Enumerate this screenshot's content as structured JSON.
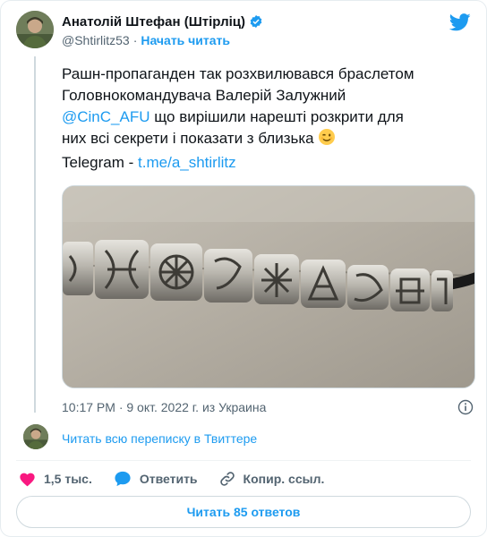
{
  "author": {
    "display_name": "Анатолій Штефан (Штірліц)",
    "handle": "@Shtirlitz53",
    "separator": "·",
    "follow_label": "Начать читать"
  },
  "tweet": {
    "line1": "Рашн-пропаганден так розхвилювався браслетом",
    "line2": "Головнокомандувача Валерій Залужний",
    "mention": "@CinC_AFU",
    "line3_rest": " що вирішили нарешті розкрити для",
    "line4": "них всі секрети і показати з близька",
    "telegram_prefix": "Telegram - ",
    "telegram_link": "t.me/a_shtirlitz"
  },
  "meta": {
    "timestamp": "10:17 PM · 9 окт. 2022 г. из Украина"
  },
  "thread": {
    "read_full": "Читать всю переписку в Твиттере"
  },
  "actions": {
    "likes": "1,5 тыс.",
    "reply": "Ответить",
    "copy_link": "Копир. ссыл."
  },
  "replies_button": "Читать 85 ответов",
  "colors": {
    "accent": "#1d9bf0",
    "like": "#f91880",
    "text": "#0f1419",
    "secondary": "#536471"
  },
  "icons": {
    "brand": "twitter-bird-icon",
    "verified": "verified-badge-icon",
    "info": "info-icon",
    "like": "heart-icon",
    "reply": "reply-bubble-icon",
    "copy": "link-icon",
    "emoji": "winking-face-emoji"
  }
}
